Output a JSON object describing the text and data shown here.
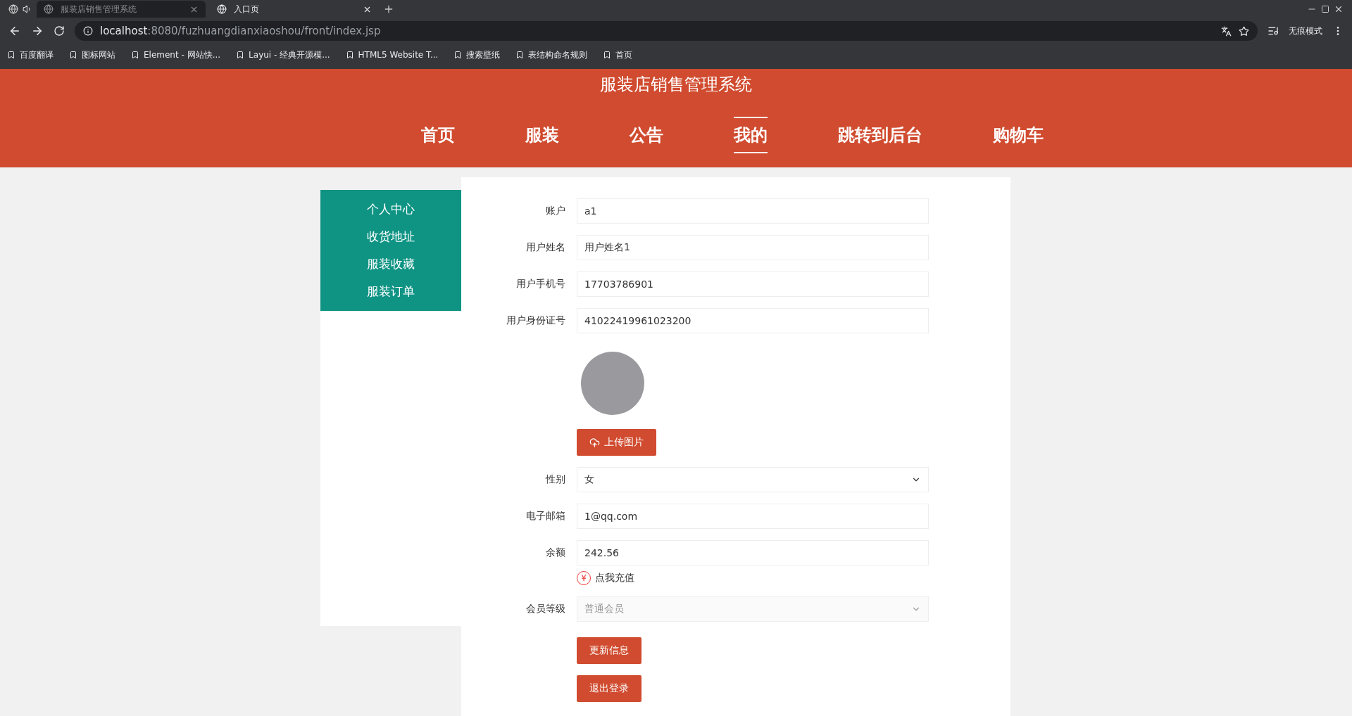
{
  "browser": {
    "tabs": [
      {
        "title": "服装店销售管理系统",
        "selected": false
      },
      {
        "title": "入口页",
        "selected": true
      }
    ],
    "url_host": "localhost",
    "url_rest": ":8080/fuzhuangdianxiaoshou/front/index.jsp",
    "profile": "无痕模式",
    "bookmarks": [
      "百度翻译",
      "图标网站",
      "Element - 网站快...",
      "Layui - 经典开源模...",
      "HTML5 Website T...",
      "搜索壁纸",
      "表结构命名规则",
      "首页"
    ]
  },
  "site_title": "服装店销售管理系统",
  "nav": [
    {
      "label": "首页",
      "selected": false
    },
    {
      "label": "服装",
      "selected": false
    },
    {
      "label": "公告",
      "selected": false
    },
    {
      "label": "我的",
      "selected": true
    },
    {
      "label": "跳转到后台",
      "selected": false
    },
    {
      "label": "购物车",
      "selected": false
    }
  ],
  "sidebar": [
    "个人中心",
    "收货地址",
    "服装收藏",
    "服装订单"
  ],
  "form": {
    "fields": [
      {
        "kind": "input",
        "label": "账户",
        "value": "a1"
      },
      {
        "kind": "input",
        "label": "用户姓名",
        "value": "用户姓名1"
      },
      {
        "kind": "input",
        "label": "用户手机号",
        "value": "17703786901"
      },
      {
        "kind": "input",
        "label": "用户身份证号",
        "value": "41022419961023200"
      },
      {
        "kind": "avatar",
        "button": "上传图片"
      },
      {
        "kind": "select",
        "label": "性别",
        "value": "女",
        "disabled": false
      },
      {
        "kind": "input",
        "label": "电子邮箱",
        "value": "1@qq.com"
      },
      {
        "kind": "input",
        "label": "余额",
        "value": "242.56"
      },
      {
        "kind": "link",
        "symbol": "¥",
        "label": "点我充值"
      },
      {
        "kind": "select",
        "label": "会员等级",
        "value": "普通会员",
        "disabled": true
      }
    ],
    "buttons": [
      "更新信息",
      "退出登录"
    ]
  }
}
